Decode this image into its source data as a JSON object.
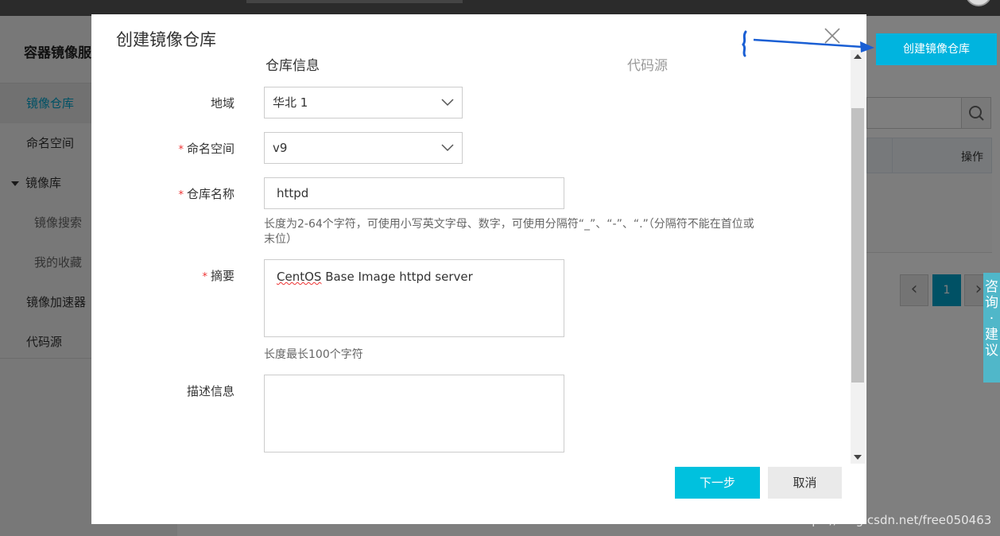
{
  "sidebar": {
    "brand": "容器镜像服",
    "items": [
      {
        "label": "镜像仓库"
      },
      {
        "label": "命名空间"
      },
      {
        "label": "镜像库"
      },
      {
        "label": "镜像搜索"
      },
      {
        "label": "我的收藏"
      },
      {
        "label": "镜像加速器"
      },
      {
        "label": "代码源"
      }
    ]
  },
  "background": {
    "create_button": "创建镜像仓库",
    "table_op_header": "操作",
    "pagination_current": "1",
    "feedback_tab": [
      "咨",
      "询",
      "·",
      "建",
      "议"
    ]
  },
  "modal": {
    "title": "创建镜像仓库",
    "steps": [
      "仓库信息",
      "代码源"
    ],
    "fields": {
      "region": {
        "label": "地域",
        "value": "华北 1"
      },
      "namespace": {
        "label": "命名空间",
        "value": "v9",
        "required": "*"
      },
      "repo_name": {
        "label": "仓库名称",
        "value": "httpd",
        "required": "*",
        "hint": "长度为2-64个字符，可使用小写英文字母、数字，可使用分隔符“_”、“-”、“.”（分隔符不能在首位或末位）"
      },
      "summary": {
        "label": "摘要",
        "value_word1": "CentOS",
        "value_rest": " Base Image httpd server",
        "required": "*",
        "hint": "长度最长100个字符"
      },
      "description": {
        "label": "描述信息",
        "value": ""
      }
    },
    "buttons": {
      "next": "下一步",
      "cancel": "取消"
    }
  },
  "watermark": "https://blog.csdn.net/free050463",
  "colors": {
    "accent": "#00c1de",
    "active_nav": "#00a2ca",
    "required": "#ee3333",
    "annotation": "#1a5fd4"
  }
}
